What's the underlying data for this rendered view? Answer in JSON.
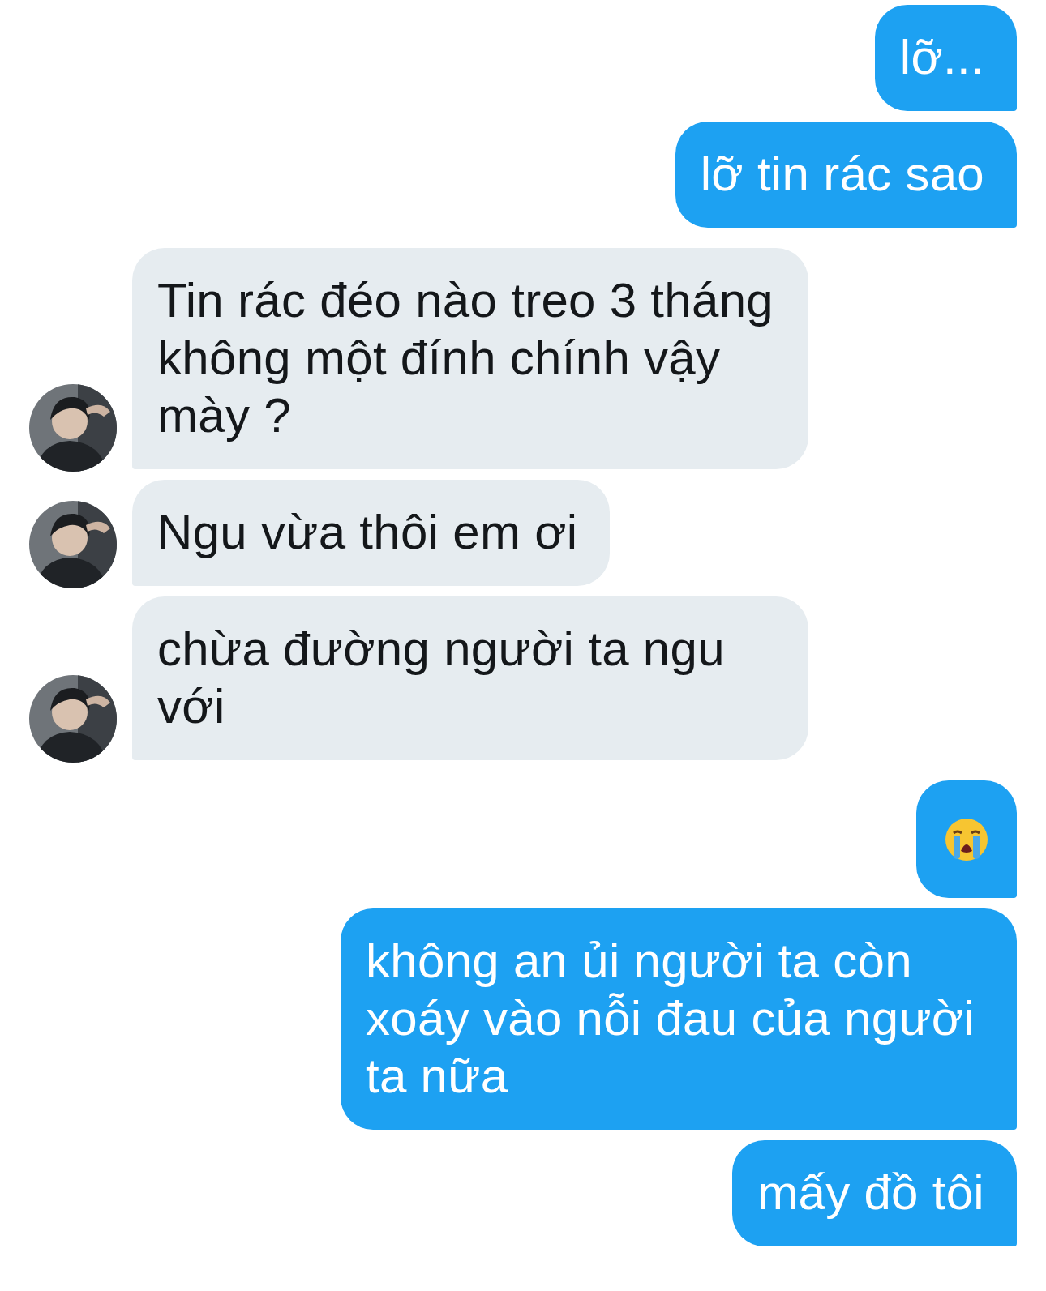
{
  "messages": [
    {
      "outgoing": true,
      "kind": "text",
      "text": "lỡ..."
    },
    {
      "outgoing": true,
      "kind": "text",
      "text": "lỡ tin rác sao"
    },
    {
      "outgoing": false,
      "kind": "text",
      "text": "Tin rác đéo nào treo 3 tháng không một đính chính vậy mày ?"
    },
    {
      "outgoing": false,
      "kind": "text",
      "text": "Ngu vừa thôi em ơi"
    },
    {
      "outgoing": false,
      "kind": "text",
      "text": "chừa đường người ta ngu với"
    },
    {
      "outgoing": true,
      "kind": "emoji"
    },
    {
      "outgoing": true,
      "kind": "text",
      "text": "không an ủi người ta còn xoáy vào nỗi đau của người ta nữa"
    },
    {
      "outgoing": true,
      "kind": "text",
      "text": "mấy đồ tôi"
    }
  ]
}
